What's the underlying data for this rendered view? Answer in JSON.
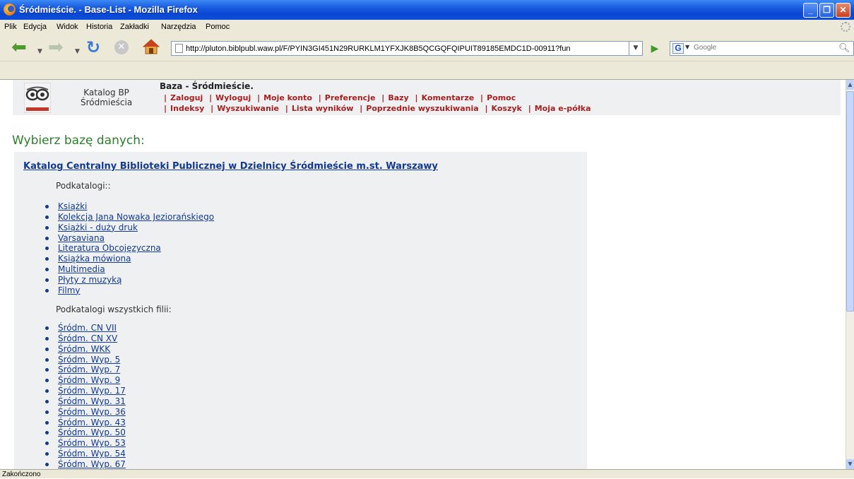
{
  "window": {
    "title": "Śródmieście. - Base-List - Mozilla Firefox",
    "minimize_glyph": "_",
    "maximize_glyph": "❐",
    "close_glyph": "✕"
  },
  "menu": [
    "Plik",
    "Edycja",
    "Widok",
    "Historia",
    "Zakładki",
    "Narzędzia",
    "Pomoc"
  ],
  "toolbar": {
    "back_icon": "back-arrow-icon",
    "forward_icon": "forward-arrow-icon",
    "reload_icon": "reload-icon",
    "stop_icon": "stop-icon",
    "home_icon": "home-icon",
    "url": "http://pluton.biblpubl.waw.pl/F/PYIN3GI451N29RURKLM1YFXJK8B5QCGQFQIPUIT89185EMDC1D-00911?fun",
    "search_engine_letter": "G",
    "search_placeholder": "Google"
  },
  "header": {
    "catalog_name": [
      "Katalog BP",
      "Śródmieścia"
    ],
    "db_title": "Baza - Śródmieście.",
    "nav_row1": [
      "Zaloguj",
      "Wyloguj",
      "Moje konto",
      "Preferencje",
      "Bazy",
      "Komentarze",
      "Pomoc"
    ],
    "nav_row2": [
      "Indeksy",
      "Wyszukiwanie",
      "Lista wyników",
      "Poprzednie wyszukiwania",
      "Koszyk",
      "Moja e-półka"
    ]
  },
  "page": {
    "heading": "Wybierz bazę danych:",
    "main_database": "Katalog Centralny Biblioteki Publicznej w Dzielnicy Śródmieście m.st. Warszawy",
    "subcatalogs_label": "Podkatalogi::",
    "subcatalogs": [
      "Książki",
      "Kolekcja Jana Nowaka Jeziorańskiego",
      "Książki - duży druk",
      "Varsaviana",
      "Literatura Obcojęzyczna",
      "Książka mówiona",
      "Multimedia",
      "Płyty z muzyką",
      "Filmy"
    ],
    "branches_label": "Podkatalogi wszystkich filii:",
    "branches": [
      "Śródm. CN VII",
      "Śródm. CN XV",
      "Śródm. WKK",
      "Śródm. Wyp. 5",
      "Śródm. Wyp. 7",
      "Śródm. Wyp. 9",
      "Śródm. Wyp. 17",
      "Śródm. Wyp. 31",
      "Śródm. Wyp. 36",
      "Śródm. Wyp. 43",
      "Śródm. Wyp. 50",
      "Śródm. Wyp. 53",
      "Śródm. Wyp. 54",
      "Śródm. Wyp. 67"
    ]
  },
  "status": "Zakończono",
  "colors": {
    "heading_green": "#2e7d2e",
    "nav_link_red": "#a32121",
    "link_blue": "#123a8d",
    "panel_bg": "#eff0f2"
  }
}
